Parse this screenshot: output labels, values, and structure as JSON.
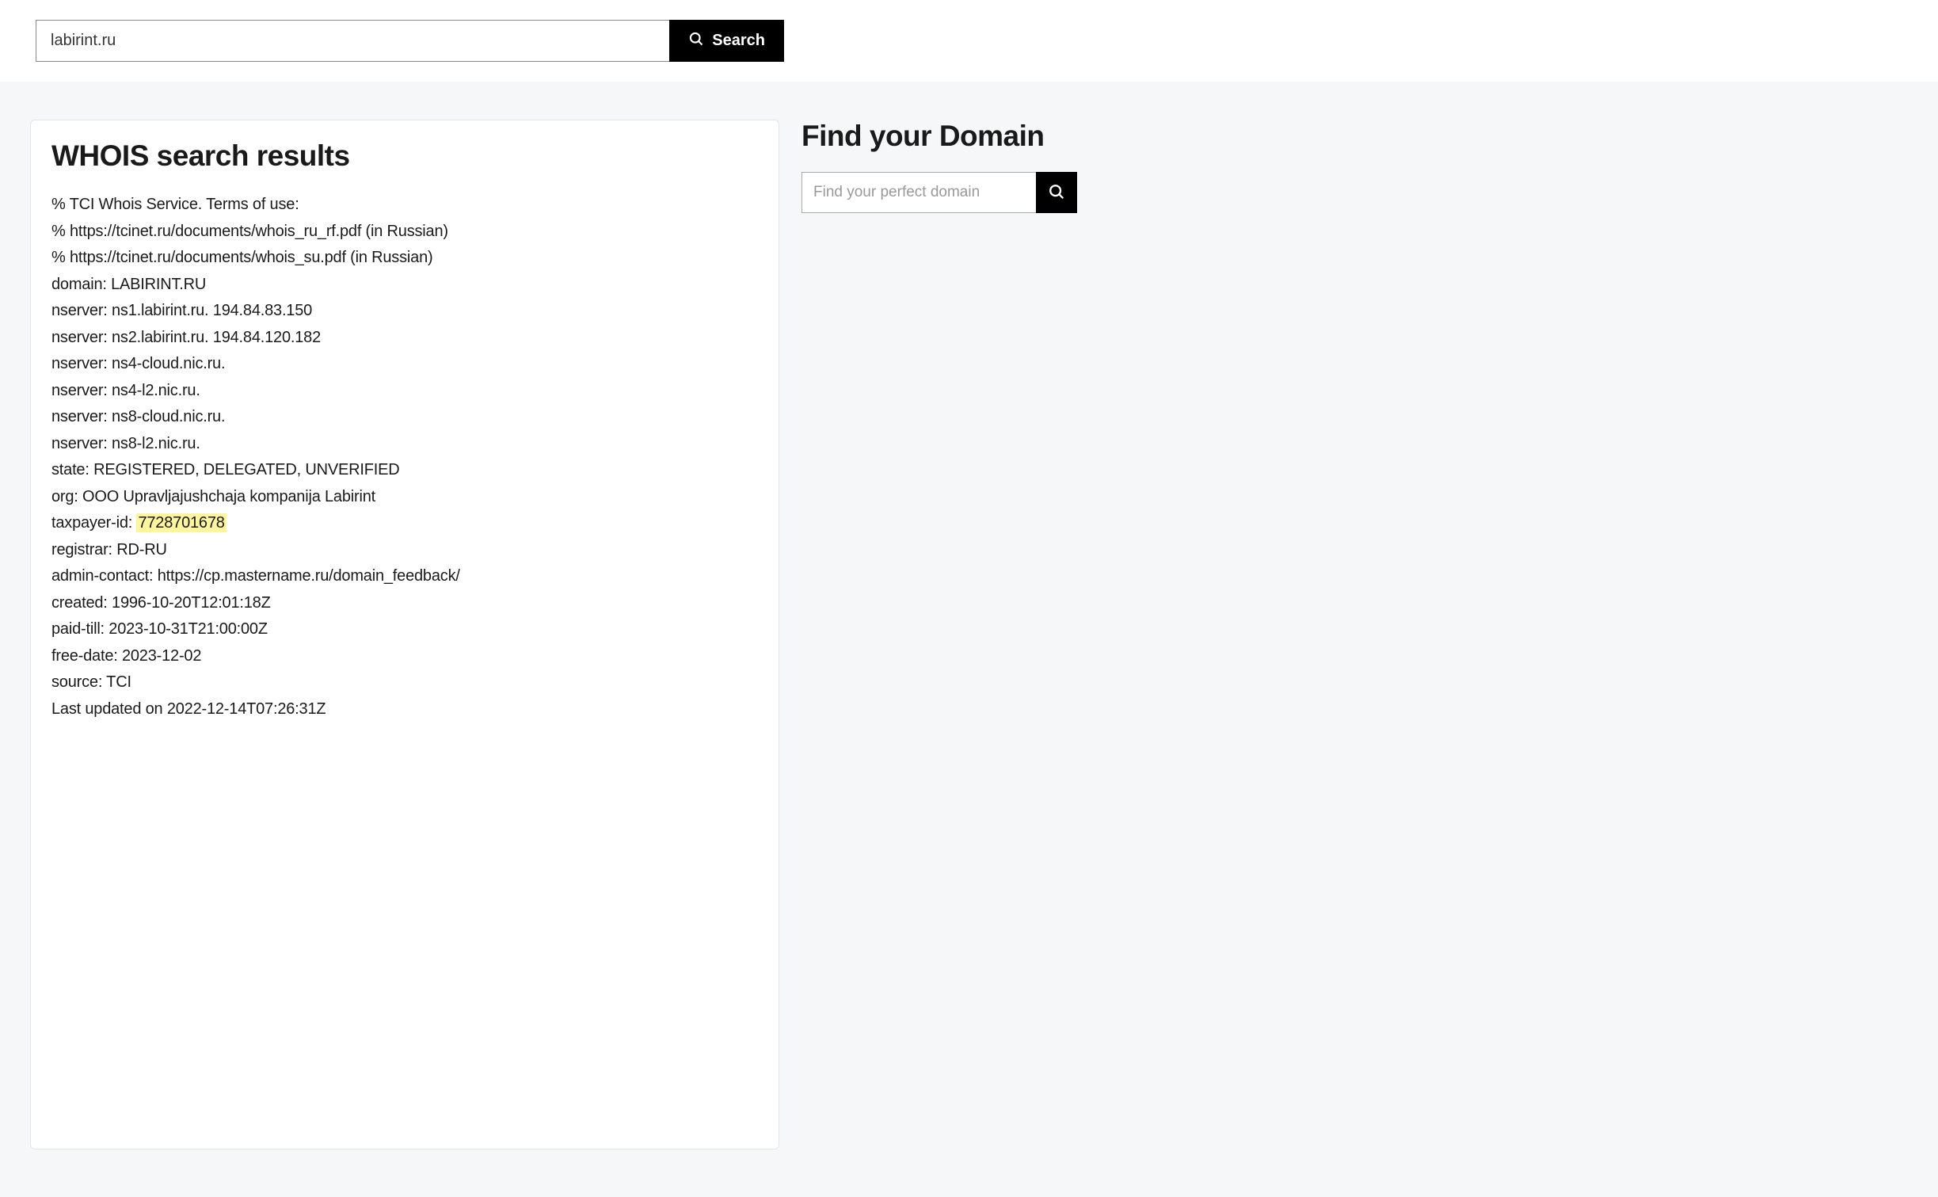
{
  "topSearch": {
    "value": "labirint.ru",
    "buttonLabel": "Search"
  },
  "results": {
    "title": "WHOIS search results",
    "lines": [
      "% TCI Whois Service. Terms of use:",
      "% https://tcinet.ru/documents/whois_ru_rf.pdf (in Russian)",
      "% https://tcinet.ru/documents/whois_su.pdf (in Russian)",
      "domain: LABIRINT.RU",
      "nserver: ns1.labirint.ru. 194.84.83.150",
      "nserver: ns2.labirint.ru. 194.84.120.182",
      "nserver: ns4-cloud.nic.ru.",
      "nserver: ns4-l2.nic.ru.",
      "nserver: ns8-cloud.nic.ru.",
      "nserver: ns8-l2.nic.ru.",
      "state: REGISTERED, DELEGATED, UNVERIFIED",
      "org: OOO Upravljajushchaja kompanija Labirint"
    ],
    "taxpayerPrefix": "taxpayer-id: ",
    "taxpayerHighlight": "7728701678",
    "linesAfter": [
      "registrar: RD-RU",
      "admin-contact: https://cp.mastername.ru/domain_feedback/",
      "created: 1996-10-20T12:01:18Z",
      "paid-till: 2023-10-31T21:00:00Z",
      "free-date: 2023-12-02",
      "source: TCI",
      "Last updated on 2022-12-14T07:26:31Z"
    ]
  },
  "sidebar": {
    "title": "Find your Domain",
    "placeholder": "Find your perfect domain"
  }
}
